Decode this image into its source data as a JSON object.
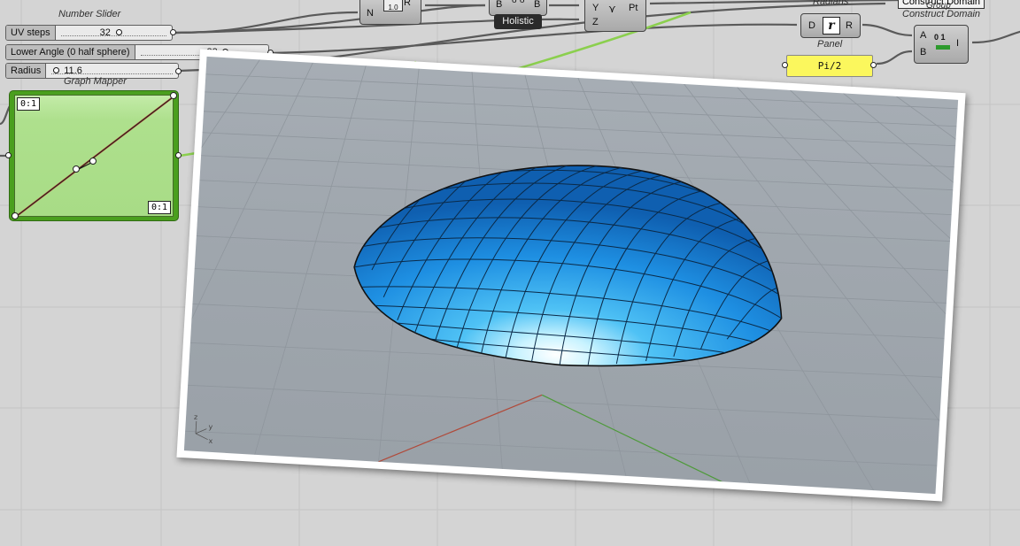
{
  "canvas": {
    "background": "#d4d4d4",
    "wire_color": "#5a5a5a",
    "selected_wire_color": "#8bcf4e"
  },
  "number_slider_caption": "Number Slider",
  "sliders": [
    {
      "label": "UV steps",
      "value": "32"
    },
    {
      "label": "Lower Angle (0 half sphere)",
      "value": "33"
    },
    {
      "label": "Radius",
      "value": "11.6"
    }
  ],
  "components": {
    "series_node": {
      "input": "N",
      "output": "R",
      "icon_text": "1.0"
    },
    "holistic_node": {
      "input": "B",
      "output": "B",
      "label": "Holistic"
    },
    "point_node": {
      "inputs": [
        "Y",
        "Z"
      ],
      "output": "Pt"
    },
    "radians_node": {
      "caption": "Radians",
      "input": "D",
      "output": "R",
      "icon": "r-icon"
    },
    "panel": {
      "caption": "Panel",
      "text": "Pi/2",
      "color": "#fbf75d"
    },
    "construct_domain": {
      "caption": "Construct Domain",
      "inputs": [
        "A",
        "B"
      ],
      "output": "I",
      "icon_text": "0 1"
    },
    "group": {
      "caption": "Group",
      "label": "Construct Domain"
    }
  },
  "graph_mapper": {
    "caption": "Graph Mapper",
    "top_left_tag": "0:1",
    "bottom_right_tag": "0:1",
    "color": "#4a9f1e"
  },
  "viewport": {
    "dome_color": "#2b9fe8",
    "axis_x_color": "#b04a3a",
    "axis_y_color": "#4e9a3a",
    "axis_gizmo": [
      "x",
      "y",
      "z"
    ]
  }
}
